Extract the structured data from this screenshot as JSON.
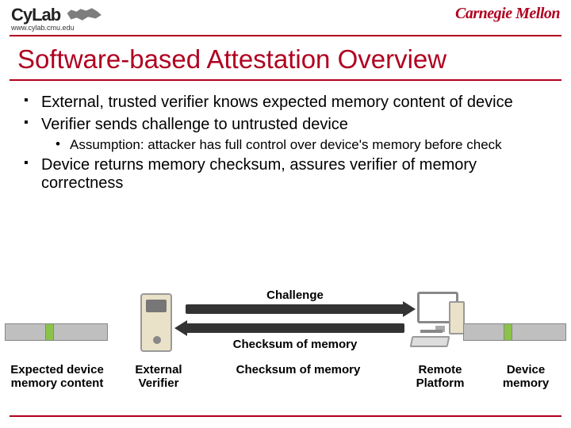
{
  "header": {
    "logo_text": "CyLab",
    "logo_url": "www.cylab.cmu.edu",
    "uni": "Carnegie Mellon"
  },
  "title": "Software-based Attestation Overview",
  "bullets": {
    "b1": "External, trusted verifier knows expected memory content of device",
    "b2": "Verifier sends challenge to untrusted device",
    "b2a": "Assumption: attacker has full control over device's memory before check",
    "b3": "Device returns memory checksum,  assures verifier of memory correctness"
  },
  "diagram": {
    "challenge": "Challenge",
    "checksum": "Checksum of memory",
    "expected": "Expected device memory content",
    "verifier": "External Verifier",
    "remote": "Remote Platform",
    "devmem": "Device memory"
  }
}
